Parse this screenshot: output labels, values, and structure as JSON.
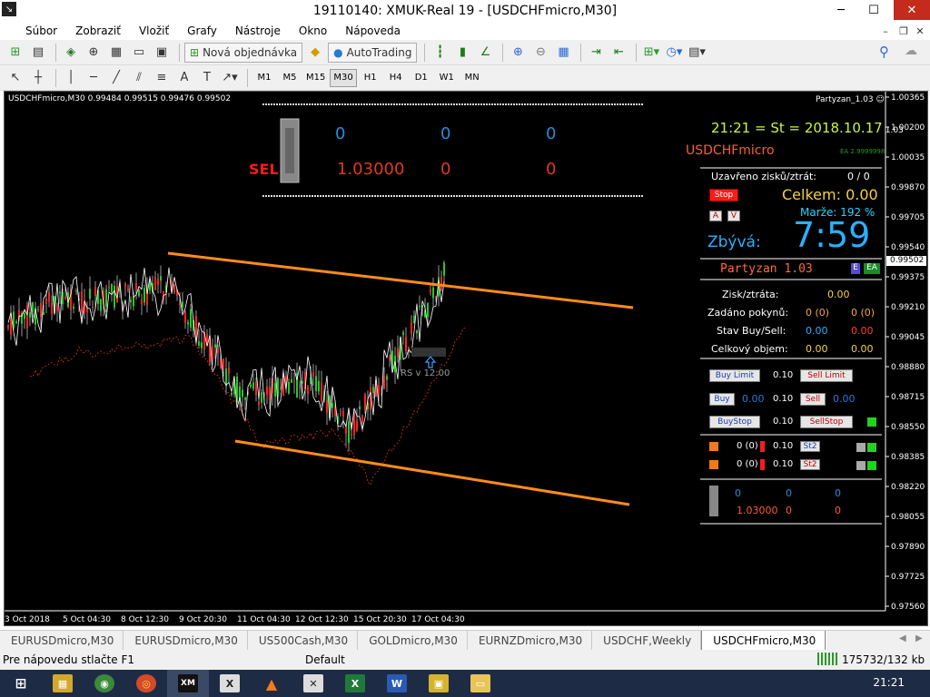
{
  "window": {
    "title": "19110140: XMUK-Real 19 - [USDCHFmicro,M30]",
    "minimize": "─",
    "maximize": "☐",
    "close": "✕"
  },
  "menu": {
    "items": [
      "Súbor",
      "Zobraziť",
      "Vložiť",
      "Grafy",
      "Nástroje",
      "Okno",
      "Nápoveda"
    ],
    "mdi_minimize": "–",
    "mdi_restore": "❐",
    "mdi_close": "✕"
  },
  "toolbar": {
    "new_order": "Nová objednávka",
    "autotrading": "AutoTrading",
    "timeframes": [
      "M1",
      "M5",
      "M15",
      "M30",
      "H1",
      "H4",
      "D1",
      "W1",
      "MN"
    ],
    "active_timeframe": "M30"
  },
  "chart": {
    "symbol_line": "USDCHFmicro,M30  0.99484 0.99515 0.99476 0.99502",
    "ea_name": "Partyzan_1.03",
    "ea_face": "☺",
    "price_labels": [
      "1.00365",
      "1.00200",
      "1.00035",
      "0.99870",
      "0.99705",
      "0.99540",
      "0.99375",
      "0.99210",
      "0.99045",
      "0.98880",
      "0.98715",
      "0.98550",
      "0.98385",
      "0.98220",
      "0.98055",
      "0.97890",
      "0.97725",
      "0.97560"
    ],
    "current_price": "0.99502",
    "ylim": [
      0.9756,
      1.00365
    ],
    "time_labels": [
      "3 Oct 2018",
      "5 Oct 04:30",
      "8 Oct 12:30",
      "9 Oct 20:30",
      "11 Oct 04:30",
      "12 Oct 12:30",
      "15 Oct 20:30",
      "17 Oct 04:30"
    ],
    "rs_label": "RS v 12:00",
    "overlay": {
      "sel_label": "SEL",
      "row1": [
        "0",
        "0",
        "0"
      ],
      "row2": [
        "1.03000",
        "0",
        "0"
      ]
    },
    "colors": {
      "up": "#22cc22",
      "down": "#ff2222",
      "wick": "#ffffff",
      "line": "#ffffff",
      "trend": "#ff8c1a",
      "dots": "#e03020",
      "background": "#000000"
    }
  },
  "panel": {
    "datetime": "21:21 = St = 2018.10.17",
    "version_small": "1.03",
    "symbol": "USDCHFmicro",
    "ea_small": "EA 2.9999998",
    "closed_pl_label": "Uzavřeno zisků/ztrát:",
    "closed_pl_value": "0 / 0",
    "stop_button": "Stop",
    "total_label": "Celkem: 0.00",
    "margin_label": "Marže:  192 %",
    "a_button": "A",
    "v_button": "V",
    "remaining_label": "Zbývá:",
    "remaining_value": "7:59",
    "partyzan_title": "Partyzan 1.03",
    "badge_e": "E",
    "badge_ea": "EA",
    "stats": [
      {
        "label": "Zisk/ztráta:",
        "v1": "0.00",
        "v2": ""
      },
      {
        "label": "Zadáno pokynů:",
        "v1": "0 (0)",
        "v2": "0 (0)"
      },
      {
        "label": "Stav Buy/Sell:",
        "v1": "0.00",
        "v2": "0.00"
      },
      {
        "label": "Celkový objem:",
        "v1": "0.00",
        "v2": "0.00"
      }
    ],
    "orders": {
      "buy_limit": "Buy Limit",
      "sell_limit": "Sell Limit",
      "buy": "Buy",
      "sell": "Sell",
      "buy_stop": "BuyStop",
      "sell_stop": "SellStop",
      "lot1": "0.10",
      "lot2": "0.10",
      "lot3": "0.10",
      "buy_price": "0.00",
      "sell_price": "0.00"
    },
    "st_rows": [
      {
        "count": "0 (0)",
        "lot": "0.10",
        "btn": "St2"
      },
      {
        "count": "0 (0)",
        "lot": "0.10",
        "btn": "St2"
      }
    ],
    "bottom": {
      "row1": [
        "0",
        "0",
        "0"
      ],
      "row2": [
        "1.03000",
        "0",
        "0"
      ]
    }
  },
  "tabs": [
    "EURUSDmicro,M30",
    "EURUSDmicro,M30",
    "US500Cash,M30",
    "GOLDmicro,M30",
    "EURNZDmicro,M30",
    "USDCHF,Weekly",
    "USDCHFmicro,M30"
  ],
  "active_tab": 6,
  "status": {
    "help": "Pre nápovedu stlačte F1",
    "profile": "Default",
    "traffic": "175732/132 kb"
  },
  "taskbar": {
    "clock": "21:21",
    "apps": [
      "XM",
      "X",
      "W"
    ]
  }
}
